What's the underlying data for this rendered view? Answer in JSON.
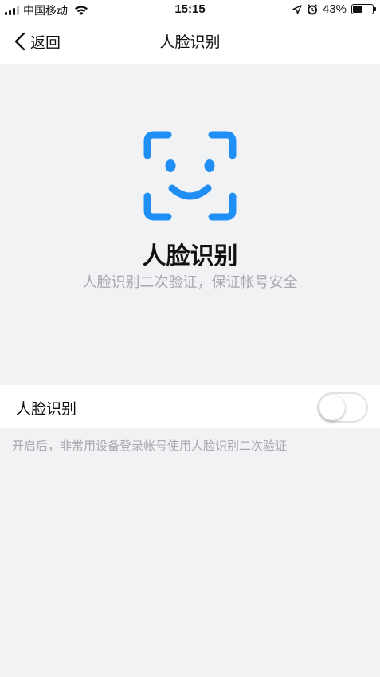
{
  "status_bar": {
    "carrier": "中国移动",
    "time": "15:15",
    "battery": "43%",
    "battery_level": 0.43
  },
  "nav": {
    "back_label": "返回",
    "title": "人脸识别"
  },
  "hero": {
    "icon": "face-recognition-icon",
    "icon_color": "#1f8ff5",
    "title": "人脸识别",
    "subtitle": "人脸识别二次验证，保证帐号安全"
  },
  "setting": {
    "label": "人脸识别",
    "toggle_on": false
  },
  "hint": "开启后，非常用设备登录帐号使用人脸识别二次验证"
}
